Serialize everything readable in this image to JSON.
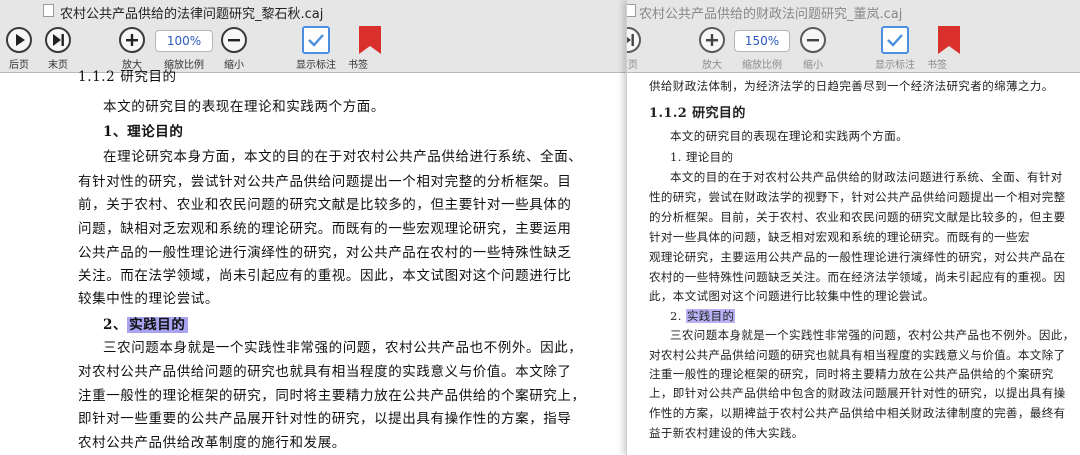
{
  "left_window": {
    "title": "农村公共产品供给的法律问题研究_黎石秋.caj",
    "toolbar": {
      "prev_label": "后页",
      "last_label": "末页",
      "zoom_in_label": "放大",
      "zoom_value": "100%",
      "zoom_label": "缩放比例",
      "zoom_out_label": "缩小",
      "show_marks_label": "显示标注",
      "bookmark_label": "书签"
    },
    "document": {
      "cut_heading": "1.1.2 研究目的",
      "lines": [
        "本文的研究目的表现在理论和实践两个方面。",
        "1、理论目的",
        "在理论研究本身方面，本文的目的在于对农村公共产品供给进行系统、全面、",
        "有针对性的研究，尝试针对公共产品供给问题提出一个相对完整的分析框架。目",
        "前，关于农村、农业和农民问题的研究文献是比较多的，但主要针对一些具体的",
        "问题，缺相对乏宏观和系统的理论研究。而既有的一些宏观理论研究，主要运用",
        "公共产品的一般性理论进行演绎性的研究，对公共产品在农村的一些特殊性缺乏",
        "关注。而在法学领域，尚未引起应有的重视。因此，本文试图对这个问题进行比",
        "较集中性的理论尝试。"
      ],
      "h2_num": "2、",
      "h2_text": "实践目的",
      "lines2": [
        "三农问题本身就是一个实践性非常强的问题，农村公共产品也不例外。因此，",
        "对农村公共产品供给问题的研究也就具有相当程度的实践意义与价值。本文除了",
        "注重一般性的理论框架的研究，同时将主要精力放在公共产品供给的个案研究上，",
        "即针对一些重要的公共产品展开针对性的研究，以提出具有操作性的方案，指导",
        "农村公共产品供给改革制度的施行和发展。"
      ]
    }
  },
  "right_window": {
    "title": "农村公共产品供给的财政法问题研究_董岚.caj",
    "toolbar": {
      "last_label": "末页",
      "zoom_in_label": "放大",
      "zoom_value": "150%",
      "zoom_label": "缩放比例",
      "zoom_out_label": "缩小",
      "show_marks_label": "显示标注",
      "bookmark_label": "书签"
    },
    "document": {
      "top_line": "供给财政法体制，为经济法学的日趋完善尽到一个经济法研究者的绵薄之力。",
      "heading": "1.1.2  研究目的",
      "lines": [
        "本文的研究目的表现在理论和实践两个方面。",
        "1. 理论目的",
        "本文的目的在于对农村公共产品供给的财政法问题进行系统、全面、有针对",
        "性的研究，尝试在财政法学的视野下，针对公共产品供给问题提出一个相对完整",
        "的分析框架。目前，关于农村、农业和农民问题的研究文献是比较多的，但主要",
        "针对一些具体的问题，缺乏相对宏观和系统的理论研究。而既有的一些宏",
        "观理论研究，主要运用公共产品的一般性理论进行演绎性的研究，对公共产品在",
        "农村的一些特殊性问题缺乏关注。而在经济法学领域，尚未引起应有的重视。因",
        "此，本文试图对这个问题进行比较集中性的理论尝试。"
      ],
      "h2_num": "2. ",
      "h2_text": "实践目的",
      "lines2": [
        "三农问题本身就是一个实践性非常强的问题，农村公共产品也不例外。因此，",
        "对农村公共产品供给问题的研究也就具有相当程度的实践意义与价值。本文除了",
        "注重一般性的理论框架的研究，同时将主要精力放在公共产品供给的个案研究",
        "上，即针对公共产品供给中包含的财政法问题展开针对性的研究，以提出具有操",
        "作性的方案，以期裨益于农村公共产品供给中相关财政法律制度的完善，最终有",
        "益于新农村建设的伟大实践。"
      ]
    }
  },
  "colors": {
    "highlight": "#a9a4f2",
    "checkbox_blue": "#4a8fe0",
    "bookmark_red": "#d9302c",
    "toolbar_bg": "#e6e6e6"
  }
}
